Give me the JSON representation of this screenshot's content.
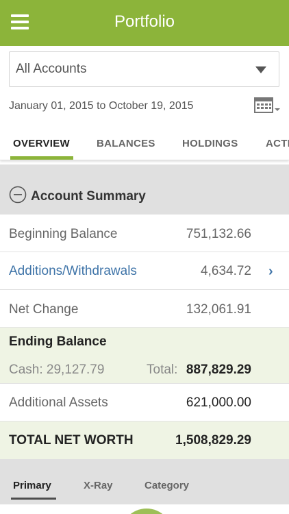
{
  "header": {
    "title": "Portfolio"
  },
  "account_select": {
    "value": "All Accounts"
  },
  "date_range": "January 01, 2015 to October 19, 2015",
  "tabs": [
    {
      "label": "OVERVIEW",
      "active": true
    },
    {
      "label": "BALANCES",
      "active": false
    },
    {
      "label": "HOLDINGS",
      "active": false
    },
    {
      "label": "ACTI",
      "active": false
    }
  ],
  "summary": {
    "title": "Account Summary",
    "beginning_balance": {
      "label": "Beginning Balance",
      "value": "751,132.66"
    },
    "additions_withdrawals": {
      "label": "Additions/Withdrawals",
      "value": "4,634.72"
    },
    "net_change": {
      "label": "Net Change",
      "value": "132,061.91"
    },
    "ending_balance": {
      "title": "Ending Balance",
      "cash": "Cash: 29,127.79",
      "total_label": "Total:",
      "total_value": "887,829.29"
    },
    "additional_assets": {
      "label": "Additional Assets",
      "value": "621,000.00"
    },
    "total_net_worth": {
      "label": "TOTAL NET WORTH",
      "value": "1,508,829.29"
    }
  },
  "subtabs": [
    {
      "label": "Primary",
      "active": true
    },
    {
      "label": "X-Ray",
      "active": false
    },
    {
      "label": "Category",
      "active": false
    }
  ],
  "colors": {
    "brand_green": "#8cb43a",
    "link_blue": "#3f74a8",
    "highlight_bg": "#eff4e4",
    "section_gray": "#e0e0e0"
  },
  "icons": [
    "menu-icon",
    "dropdown-caret-icon",
    "calendar-icon",
    "collapse-minus-icon",
    "chevron-right-icon"
  ]
}
